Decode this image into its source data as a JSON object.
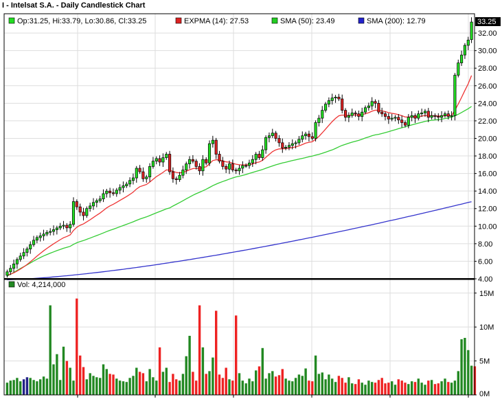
{
  "title": "I - Intelsat S.A. - Daily Candlestick Chart",
  "colors": {
    "up": "#22dd22",
    "down": "#dd2222",
    "outline": "#000000",
    "expma": "#ee3333",
    "sma50": "#33cc33",
    "sma200": "#3333cc",
    "vol_up": "#228822",
    "vol_down": "#ee2222",
    "vol_flat": "#222288",
    "grid": "#dddddd",
    "last_price_bg": "#000000",
    "last_price_fg": "#ffffff"
  },
  "legend": {
    "ohlc": "Op:31.25, Hi:33.79, Lo:30.86, Cl:33.25",
    "expma": "EXPMA (14): 27.53",
    "sma50": "SMA (50): 23.49",
    "sma200": "SMA (200): 12.79",
    "volume": "Vol: 4,214,000"
  },
  "chart_data": {
    "type": "candlestick",
    "title": "I - Intelsat S.A. - Daily Candlestick Chart",
    "price_axis": {
      "ticks": [
        "4.00",
        "6.00",
        "8.00",
        "10.00",
        "12.00",
        "14.00",
        "16.00",
        "18.00",
        "20.00",
        "22.00",
        "24.00",
        "26.00",
        "28.00",
        "30.00",
        "32.00"
      ],
      "range": [
        4,
        34.2
      ]
    },
    "last_price": "33.25",
    "volume_axis": {
      "ticks": [
        "0M",
        "5M",
        "10M",
        "15M"
      ],
      "range": [
        0,
        17
      ]
    },
    "grid": true,
    "last_bar": {
      "open": 31.25,
      "high": 33.79,
      "low": 30.86,
      "close": 33.25,
      "volume": 4214000
    },
    "closes": [
      4.8,
      5.2,
      5.7,
      6.2,
      6.6,
      7.0,
      7.4,
      7.9,
      8.4,
      8.7,
      8.9,
      9.1,
      9.3,
      9.4,
      9.6,
      9.8,
      10.0,
      10.1,
      9.8,
      10.2,
      12.8,
      12.2,
      11.6,
      11.2,
      12.0,
      12.3,
      12.7,
      12.9,
      13.1,
      13.7,
      14.0,
      13.8,
      13.7,
      14.1,
      14.4,
      14.6,
      14.8,
      15.2,
      15.5,
      16.6,
      16.2,
      15.4,
      15.6,
      16.8,
      17.4,
      17.7,
      17.3,
      17.8,
      18.2,
      16.2,
      15.4,
      15.3,
      15.8,
      16.4,
      17.1,
      17.6,
      17.4,
      16.8,
      16.3,
      17.6,
      17.2,
      19.4,
      19.8,
      18.2,
      17.4,
      16.8,
      16.5,
      17.1,
      16.4,
      16.3,
      16.6,
      16.9,
      16.9,
      17.2,
      17.6,
      18.2,
      17.8,
      18.7,
      20.1,
      20.3,
      20.6,
      20.0,
      19.5,
      18.9,
      19.0,
      19.2,
      19.4,
      19.5,
      19.9,
      20.3,
      20.5,
      20.2,
      20.0,
      21.8,
      22.3,
      23.2,
      23.9,
      24.3,
      24.6,
      24.7,
      24.5,
      23.2,
      22.4,
      22.6,
      22.9,
      22.8,
      22.5,
      23.0,
      23.5,
      23.7,
      24.2,
      24.0,
      23.0,
      22.8,
      22.5,
      22.2,
      22.3,
      22.4,
      22.1,
      21.8,
      21.5,
      22.4,
      22.6,
      22.3,
      22.8,
      22.9,
      23.1,
      22.4,
      22.6,
      22.5,
      22.4,
      22.6,
      22.8,
      22.5,
      22.6,
      27.2,
      28.6,
      29.5,
      30.6,
      31.2,
      33.25
    ],
    "volumes": [
      1.8,
      2.1,
      2.2,
      2.5,
      2.0,
      2.3,
      2.6,
      2.5,
      2.2,
      2.0,
      2.3,
      2.7,
      2.4,
      13.2,
      4.5,
      6.0,
      2.2,
      7.1,
      5.0,
      4.0,
      2.1,
      14.2,
      5.8,
      4.1,
      2.3,
      3.2,
      2.8,
      2.6,
      2.5,
      4.5,
      3.8,
      3.1,
      3.0,
      2.4,
      2.1,
      2.0,
      1.9,
      2.5,
      2.8,
      4.0,
      3.4,
      3.2,
      2.0,
      3.8,
      2.6,
      2.1,
      7.0,
      3.4,
      4.0,
      1.9,
      3.1,
      2.3,
      2.1,
      3.1,
      5.7,
      8.7,
      3.4,
      2.1,
      13.2,
      7.0,
      3.1,
      3.5,
      5.5,
      12.4,
      3.0,
      2.5,
      4.0,
      2.3,
      2.1,
      11.7,
      3.2,
      2.1,
      1.7,
      2.4,
      2.0,
      3.6,
      4.2,
      6.9,
      2.4,
      3.2,
      3.5,
      2.7,
      2.9,
      3.8,
      2.4,
      2.1,
      2.0,
      2.5,
      3.0,
      2.8,
      3.9,
      2.1,
      2.0,
      5.8,
      3.1,
      3.3,
      2.3,
      3.0,
      2.4,
      1.9,
      2.8,
      2.5,
      1.8,
      2.6,
      1.7,
      1.6,
      2.3,
      1.8,
      1.5,
      2.1,
      1.9,
      1.8,
      2.2,
      2.5,
      1.7,
      1.8,
      2.0,
      1.5,
      2.3,
      2.1,
      1.8,
      1.6,
      2.0,
      1.9,
      2.4,
      1.8,
      1.5,
      2.1,
      2.2,
      1.6,
      1.7,
      2.0,
      2.4,
      1.9,
      1.8,
      2.1,
      3.5,
      8.2,
      8.4,
      6.6,
      4.3,
      4.214
    ]
  }
}
